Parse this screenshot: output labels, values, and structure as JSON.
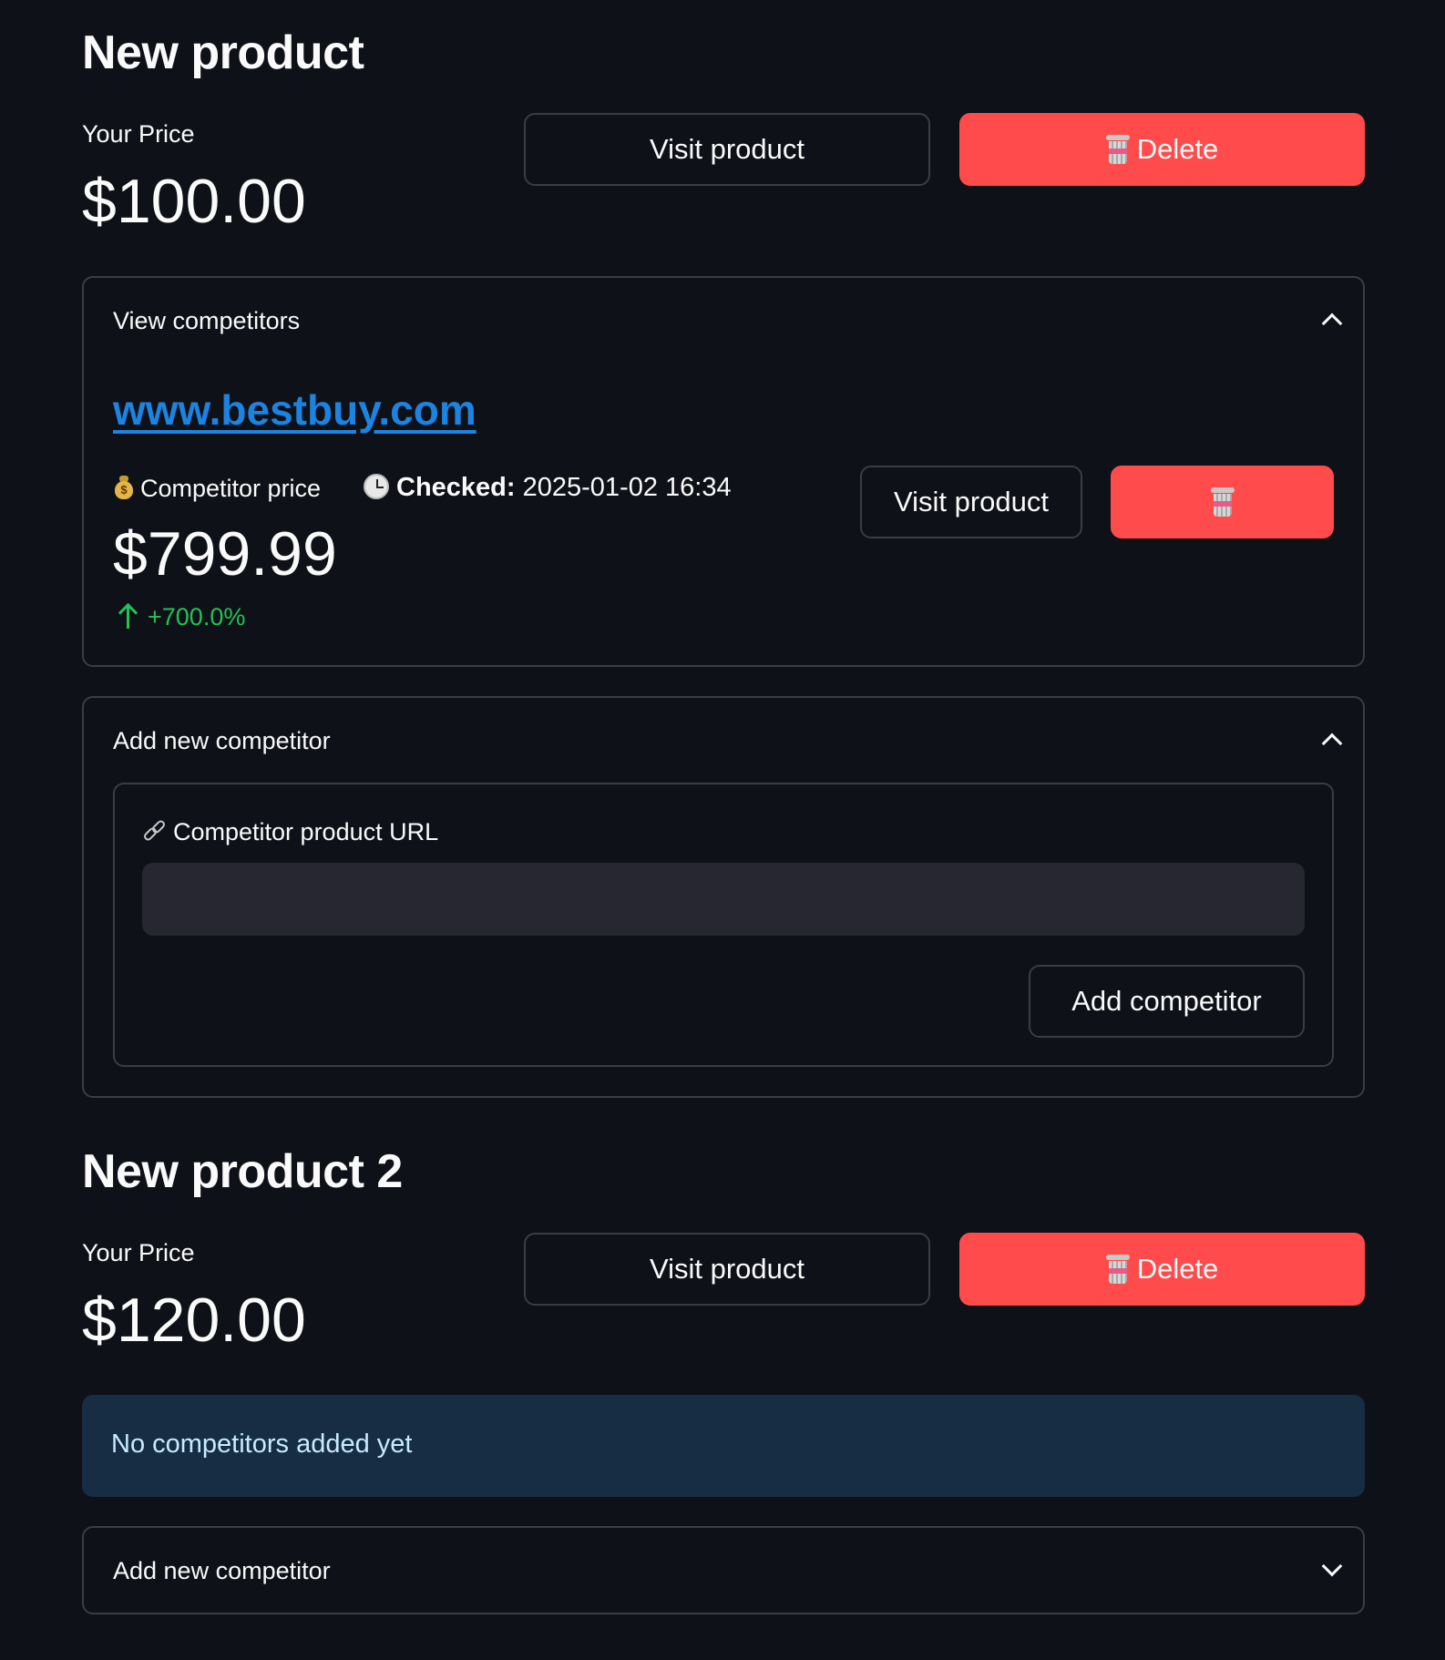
{
  "products": [
    {
      "title": "New product",
      "price_label": "Your Price",
      "price_value": "$100.00",
      "visit_label": "Visit product",
      "delete_label": "Delete",
      "view_competitors": {
        "label": "View competitors",
        "competitor": {
          "url_text": "www.bestbuy.com",
          "price_label": "Competitor price",
          "checked_label": "Checked:",
          "checked_value": "2025-01-02 16:34",
          "price_value": "$799.99",
          "delta": "+700.0%",
          "visit_label": "Visit product"
        }
      },
      "add_competitor": {
        "label": "Add new competitor",
        "url_field_label": "Competitor product URL",
        "url_value": "",
        "submit_label": "Add competitor"
      }
    },
    {
      "title": "New product 2",
      "price_label": "Your Price",
      "price_value": "$120.00",
      "visit_label": "Visit product",
      "delete_label": "Delete",
      "info_message": "No competitors added yet",
      "add_competitor": {
        "label": "Add new competitor"
      }
    }
  ],
  "colors": {
    "background": "#0e1117",
    "primary": "#ff4b4b",
    "link": "#1c83e1",
    "positive_delta": "#21c354",
    "info_bg": "#172d43",
    "info_text": "#c7ebff"
  },
  "icons": {
    "delete": "trash-icon",
    "competitor_price": "moneybag-icon",
    "checked": "clock-icon",
    "delta": "arrow-up-icon",
    "url_field": "link-icon",
    "expander_open": "chevron-up-icon",
    "expander_closed": "chevron-down-icon"
  }
}
